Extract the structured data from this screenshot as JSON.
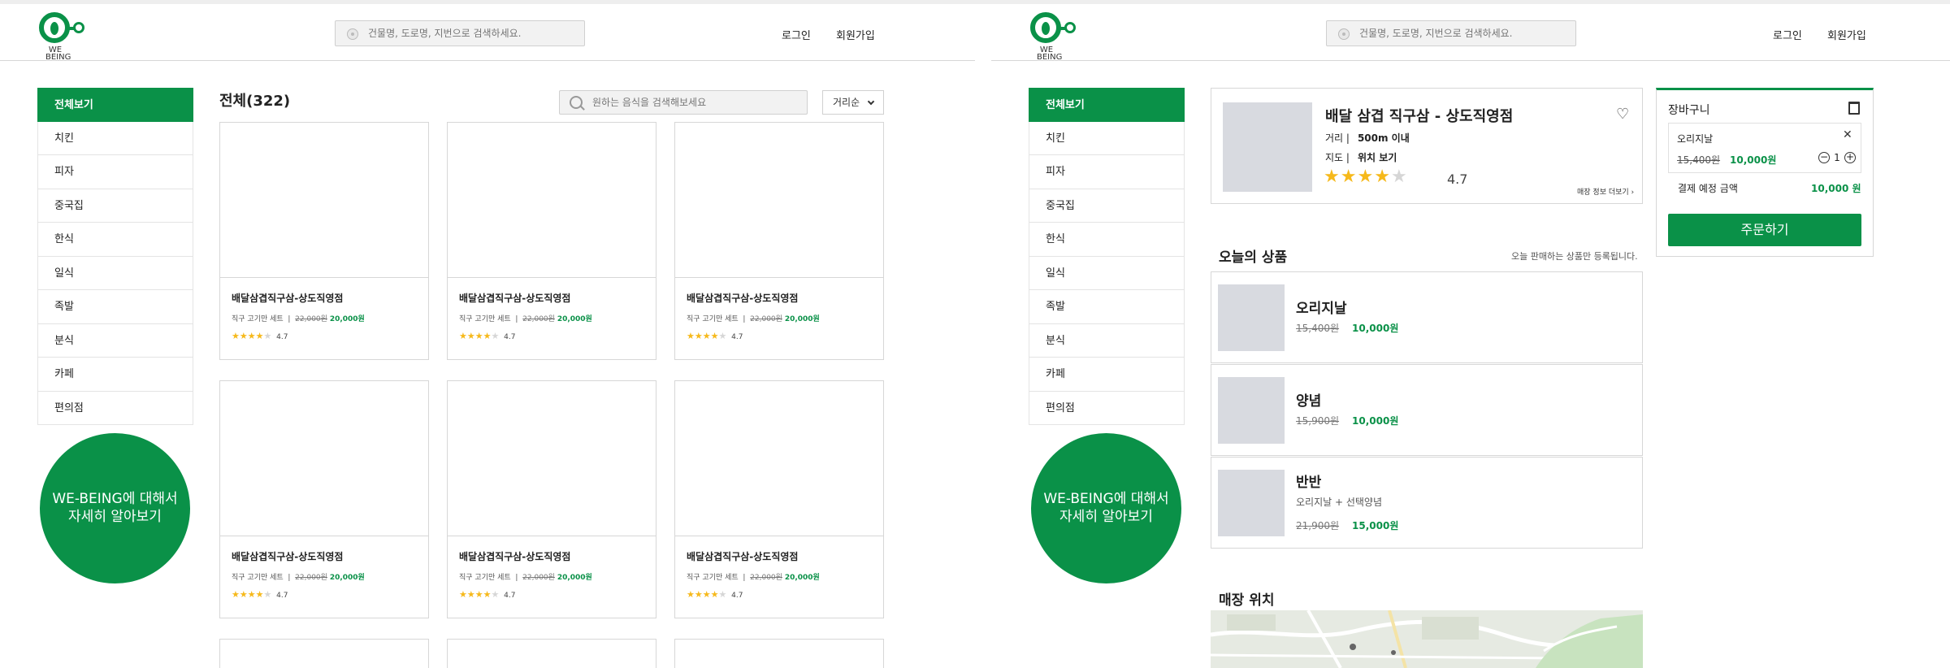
{
  "brand": {
    "logo_text": "WE\nBEING",
    "accent": "#0a9148"
  },
  "header": {
    "search_placeholder": "건물명, 도로명, 지번으로 검색하세요.",
    "login": "로그인",
    "signup": "회원가입"
  },
  "sidebar": {
    "items": [
      {
        "label": "전체보기",
        "active": true
      },
      {
        "label": "치킨"
      },
      {
        "label": "피자"
      },
      {
        "label": "중국집"
      },
      {
        "label": "한식"
      },
      {
        "label": "일식"
      },
      {
        "label": "족발"
      },
      {
        "label": "분식"
      },
      {
        "label": "카페"
      },
      {
        "label": "편의점"
      }
    ],
    "promo_line1": "WE-BEING에 대해서",
    "promo_line2": "자세히 알아보기"
  },
  "list": {
    "title": "전체(322)",
    "search_placeholder": "원하는 음식을 검색해보세요",
    "sort": "거리순",
    "cards": [
      {
        "name": "배달삼겹직구삼-상도직영점",
        "menu": "직구 고기만 세트",
        "old_price": "22,000원",
        "price": "20,000원",
        "rating": "4.7",
        "stars": 4
      },
      {
        "name": "배달삼겹직구삼-상도직영점",
        "menu": "직구 고기만 세트",
        "old_price": "22,000원",
        "price": "20,000원",
        "rating": "4.7",
        "stars": 4
      },
      {
        "name": "배달삼겹직구삼-상도직영점",
        "menu": "직구 고기만 세트",
        "old_price": "22,000원",
        "price": "20,000원",
        "rating": "4.7",
        "stars": 4
      },
      {
        "name": "배달삼겹직구삼-상도직영점",
        "menu": "직구 고기만 세트",
        "old_price": "22,000원",
        "price": "20,000원",
        "rating": "4.7",
        "stars": 4
      },
      {
        "name": "배달삼겹직구삼-상도직영점",
        "menu": "직구 고기만 세트",
        "old_price": "22,000원",
        "price": "20,000원",
        "rating": "4.7",
        "stars": 4
      },
      {
        "name": "배달삼겹직구삼-상도직영점",
        "menu": "직구 고기만 세트",
        "old_price": "22,000원",
        "price": "20,000원",
        "rating": "4.7",
        "stars": 4
      }
    ]
  },
  "store": {
    "name": "배달 삼겹 직구삼 - 상도직영점",
    "distance_label": "거리 |",
    "distance": "500m 이내",
    "map_label": "지도 |",
    "map_link": "위치 보기",
    "rating": "4.7",
    "stars": 4,
    "more": "매장 정보 더보기",
    "today_title": "오늘의 상품",
    "today_note": "오늘 판매하는 상품만 등록됩니다.",
    "products": [
      {
        "name": "오리지날",
        "desc": "",
        "old_price": "15,400원",
        "price": "10,000원"
      },
      {
        "name": "양념",
        "desc": "",
        "old_price": "15,900원",
        "price": "10,000원"
      },
      {
        "name": "반반",
        "desc": "오리지날 + 선택양념",
        "old_price": "21,900원",
        "price": "15,000원"
      }
    ],
    "location_title": "매장 위치"
  },
  "cart": {
    "title": "장바구니",
    "item_name": "오리지날",
    "item_old_price": "15,400원",
    "item_price": "10,000원",
    "qty": "1",
    "total_label": "결제 예정 금액",
    "total": "10,000 원",
    "order_button": "주문하기"
  }
}
